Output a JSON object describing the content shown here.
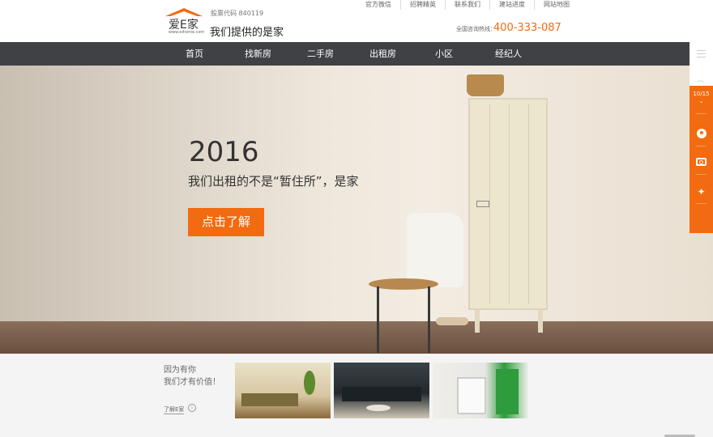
{
  "header": {
    "logo_text": "爱E家",
    "logo_sub": "www.eihome.com",
    "stock_code": "股票代码 840119",
    "slogan": "我们提供的是家",
    "top_links": [
      "官方微信",
      "招聘精英",
      "联系我们",
      "建站进度",
      "网站地图"
    ],
    "hotline_label": "全国咨询热线：",
    "hotline": "400-333-087"
  },
  "nav": {
    "items": [
      "首页",
      "找新房",
      "二手房",
      "出租房",
      "小区",
      "经纪人"
    ]
  },
  "hero": {
    "year": "2016",
    "subtitle": "我们出租的不是“暂住所”，是家",
    "cta": "点击了解"
  },
  "sidebar": {
    "page_indicator": "10/15",
    "arrow": "⌄",
    "icons": [
      "menu-icon",
      "up-arrow-icon",
      "user-icon",
      "camera-icon",
      "twitter-icon"
    ],
    "accent": "#f26b10"
  },
  "bottom": {
    "line1": "因为有你",
    "line2": "我们才有价值！",
    "link": "了解E家",
    "arrow": "›"
  },
  "colors": {
    "accent": "#f26b10",
    "nav_bg": "#404145",
    "page_bg": "#f4f4f4"
  }
}
